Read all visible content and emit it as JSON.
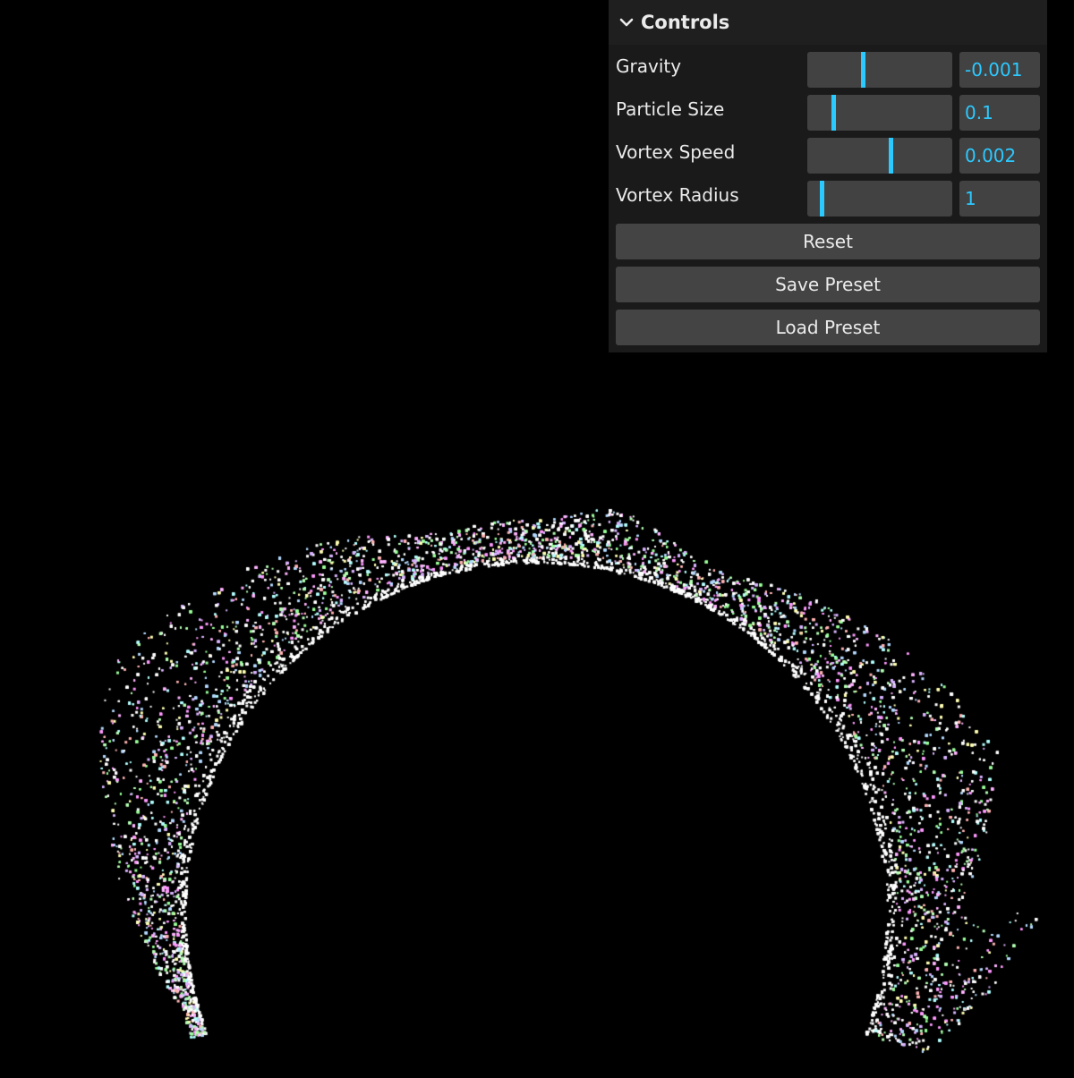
{
  "panel": {
    "title": "Controls",
    "collapse_icon": "chevron-down-icon",
    "accent": "#2cc9ff",
    "controls": [
      {
        "label": "Gravity",
        "value": "-0.001",
        "level": 0.38
      },
      {
        "label": "Particle Size",
        "value": "0.1",
        "level": 0.17
      },
      {
        "label": "Vortex Speed",
        "value": "0.002",
        "level": 0.58
      },
      {
        "label": "Vortex Radius",
        "value": "1",
        "level": 0.09
      }
    ],
    "buttons": {
      "reset": "Reset",
      "save": "Save Preset",
      "load": "Load Preset"
    }
  }
}
